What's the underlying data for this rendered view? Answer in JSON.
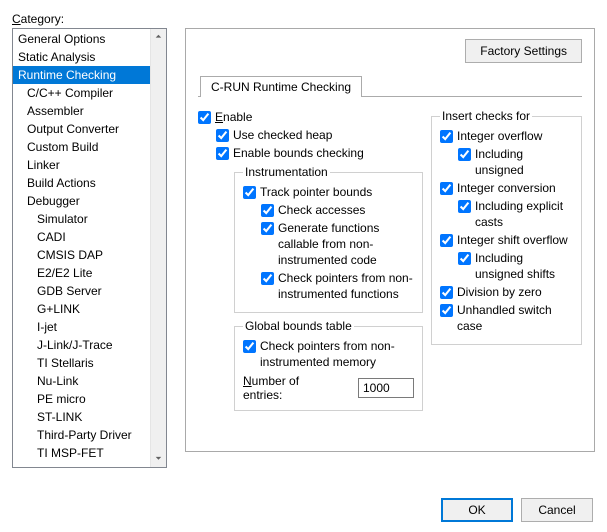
{
  "category_label": "Category:",
  "categories": [
    {
      "label": "General Options",
      "indent": 0
    },
    {
      "label": "Static Analysis",
      "indent": 0
    },
    {
      "label": "Runtime Checking",
      "indent": 0,
      "selected": true
    },
    {
      "label": "C/C++ Compiler",
      "indent": 1
    },
    {
      "label": "Assembler",
      "indent": 1
    },
    {
      "label": "Output Converter",
      "indent": 1
    },
    {
      "label": "Custom Build",
      "indent": 1
    },
    {
      "label": "Linker",
      "indent": 1
    },
    {
      "label": "Build Actions",
      "indent": 1
    },
    {
      "label": "Debugger",
      "indent": 1
    },
    {
      "label": "Simulator",
      "indent": 2
    },
    {
      "label": "CADI",
      "indent": 2
    },
    {
      "label": "CMSIS DAP",
      "indent": 2
    },
    {
      "label": "E2/E2 Lite",
      "indent": 2
    },
    {
      "label": "GDB Server",
      "indent": 2
    },
    {
      "label": "G+LINK",
      "indent": 2
    },
    {
      "label": "I-jet",
      "indent": 2
    },
    {
      "label": "J-Link/J-Trace",
      "indent": 2
    },
    {
      "label": "TI Stellaris",
      "indent": 2
    },
    {
      "label": "Nu-Link",
      "indent": 2
    },
    {
      "label": "PE micro",
      "indent": 2
    },
    {
      "label": "ST-LINK",
      "indent": 2
    },
    {
      "label": "Third-Party Driver",
      "indent": 2
    },
    {
      "label": "TI MSP-FET",
      "indent": 2
    }
  ],
  "buttons": {
    "factory": "Factory Settings",
    "ok": "OK",
    "cancel": "Cancel"
  },
  "tab_label": "C-RUN Runtime Checking",
  "checkboxes": {
    "enable": "Enable",
    "use_checked_heap": "Use checked heap",
    "enable_bounds": "Enable bounds checking",
    "instrumentation_legend": "Instrumentation",
    "track_ptr": "Track pointer bounds",
    "check_accesses": "Check accesses",
    "gen_funcs": "Generate functions callable from non-instrumented code",
    "check_ptr_noninst_funcs": "Check pointers from non-instrumented functions",
    "global_legend": "Global bounds table",
    "check_ptr_noninst_mem": "Check pointers from non-instrumented memory",
    "num_entries_label": "Number of entries:",
    "num_entries_value": "1000",
    "insert_legend": "Insert checks for",
    "int_overflow": "Integer overflow",
    "incl_unsigned": "Including unsigned",
    "int_conv": "Integer conversion",
    "incl_explicit": "Including explicit casts",
    "int_shift": "Integer shift overflow",
    "incl_unsigned_shifts": "Including unsigned shifts",
    "div_zero": "Division by zero",
    "unhandled_switch": "Unhandled switch case"
  }
}
